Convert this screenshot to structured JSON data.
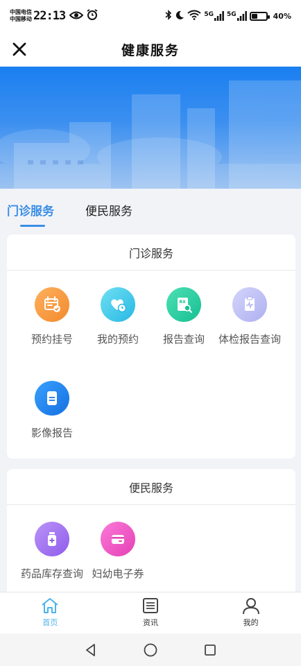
{
  "status_bar": {
    "carrier_1": "中国电信",
    "carrier_2": "中国移动",
    "time": "22:13",
    "network_1": "5G",
    "network_2": "5G",
    "battery_text": "40%",
    "battery_level": 0.4
  },
  "header": {
    "title": "健康服务"
  },
  "tabs": [
    {
      "label": "门诊服务",
      "active": true
    },
    {
      "label": "便民服务",
      "active": false
    }
  ],
  "sections": [
    {
      "title": "门诊服务",
      "items": [
        {
          "label": "预约挂号",
          "icon": "calendar-check-icon",
          "color": "#f59a3c"
        },
        {
          "label": "我的预约",
          "icon": "heart-clock-icon",
          "color": "#3cc9ea"
        },
        {
          "label": "报告查询",
          "icon": "report-search-icon",
          "color": "#27c8a0"
        },
        {
          "label": "体检报告查询",
          "icon": "clipboard-pulse-icon",
          "color": "#b8b8f4"
        },
        {
          "label": "影像报告",
          "icon": "document-icon",
          "color": "#1f86f2"
        }
      ]
    },
    {
      "title": "便民服务",
      "items": [
        {
          "label": "药品库存查询",
          "icon": "medicine-bottle-icon",
          "color": "#a374f0"
        },
        {
          "label": "妇幼电子券",
          "icon": "wallet-icon",
          "color": "#ee58c8"
        }
      ]
    }
  ],
  "bottom_nav": [
    {
      "label": "首页",
      "icon": "home-icon",
      "active": true
    },
    {
      "label": "资讯",
      "icon": "news-icon",
      "active": false
    },
    {
      "label": "我的",
      "icon": "user-icon",
      "active": false
    }
  ],
  "colors": {
    "accent": "#3a8ee6",
    "active_nav": "#4cb3e8"
  }
}
